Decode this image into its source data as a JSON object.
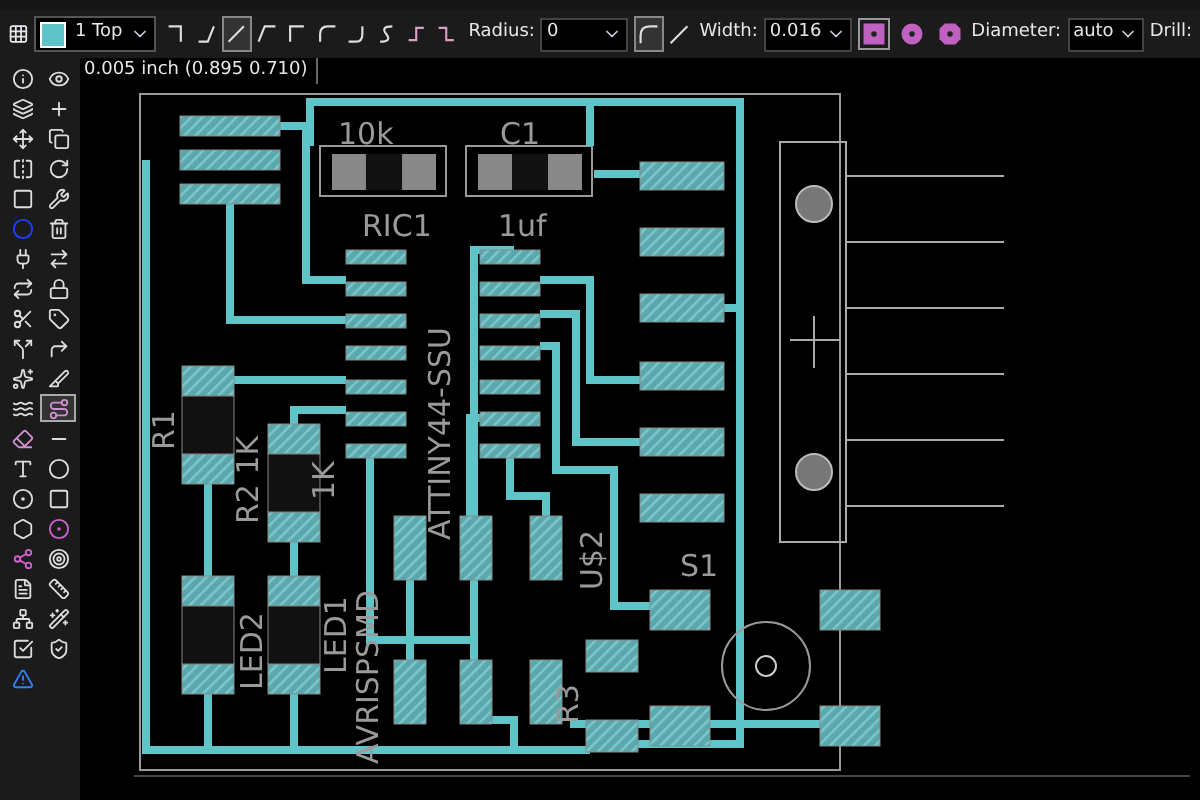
{
  "toolbar": {
    "layer": {
      "value": "1 Top",
      "color": "#5fc4c8"
    },
    "bends": [
      {
        "kind": "corner-right",
        "selected": false
      },
      {
        "kind": "slant-corner",
        "selected": false
      },
      {
        "kind": "diagonal",
        "selected": true
      },
      {
        "kind": "slant-up",
        "selected": false
      },
      {
        "kind": "corner-left",
        "selected": false
      },
      {
        "kind": "round-left",
        "selected": false
      },
      {
        "kind": "round-right",
        "selected": false
      },
      {
        "kind": "s-curve",
        "selected": false
      },
      {
        "kind": "follow-left",
        "selected": false
      },
      {
        "kind": "follow-right",
        "selected": false
      }
    ],
    "radius": {
      "label": "Radius:",
      "value": "0"
    },
    "miters": [
      {
        "kind": "round",
        "selected": true
      },
      {
        "kind": "straight",
        "selected": false
      }
    ],
    "width": {
      "label": "Width:",
      "value": "0.016"
    },
    "via_shapes": [
      {
        "kind": "square",
        "selected": true
      },
      {
        "kind": "round",
        "selected": false
      },
      {
        "kind": "octagon",
        "selected": false
      }
    ],
    "diameter": {
      "label": "Diameter:",
      "value": "auto"
    },
    "drill": {
      "label": "Drill:"
    }
  },
  "coordinates": "0.005 inch (0.895 0.710)",
  "tools": [
    {
      "kind": "info",
      "selected": false
    },
    {
      "kind": "eye",
      "selected": false
    },
    {
      "kind": "layers",
      "selected": false
    },
    {
      "kind": "mark",
      "selected": false
    },
    {
      "kind": "move",
      "selected": false
    },
    {
      "kind": "copy",
      "selected": false
    },
    {
      "kind": "mirror",
      "selected": false
    },
    {
      "kind": "rotate",
      "selected": false
    },
    {
      "kind": "group",
      "selected": false
    },
    {
      "kind": "wrench",
      "selected": false
    },
    {
      "kind": "dot",
      "selected": false
    },
    {
      "kind": "delete",
      "selected": false
    },
    {
      "kind": "plug",
      "selected": false
    },
    {
      "kind": "replace",
      "selected": false
    },
    {
      "kind": "swap",
      "selected": false
    },
    {
      "kind": "lock",
      "selected": false
    },
    {
      "kind": "smash",
      "selected": false
    },
    {
      "kind": "value",
      "selected": false
    },
    {
      "kind": "split",
      "selected": false
    },
    {
      "kind": "miter",
      "selected": false
    },
    {
      "kind": "optimize",
      "selected": false
    },
    {
      "kind": "slice",
      "selected": false
    },
    {
      "kind": "meander",
      "selected": false
    },
    {
      "kind": "route",
      "selected": true
    },
    {
      "kind": "ripup",
      "selected": false
    },
    {
      "kind": "wire",
      "selected": false
    },
    {
      "kind": "text",
      "selected": false
    },
    {
      "kind": "circle",
      "selected": false
    },
    {
      "kind": "arc",
      "selected": false
    },
    {
      "kind": "rect",
      "selected": false
    },
    {
      "kind": "polygon",
      "selected": false
    },
    {
      "kind": "via",
      "selected": false
    },
    {
      "kind": "signal",
      "selected": false
    },
    {
      "kind": "hole",
      "selected": false
    },
    {
      "kind": "attribute",
      "selected": false
    },
    {
      "kind": "dimension",
      "selected": false
    },
    {
      "kind": "ratsnest",
      "selected": false
    },
    {
      "kind": "autoroute",
      "selected": false
    },
    {
      "kind": "erc",
      "selected": false
    },
    {
      "kind": "drc",
      "selected": false
    },
    {
      "kind": "errors",
      "selected": false
    }
  ],
  "board": {
    "labels": [
      {
        "text": "10k",
        "kind": "flat"
      },
      {
        "text": "C1",
        "kind": "flat"
      },
      {
        "text": "RIC1",
        "kind": "flat"
      },
      {
        "text": "1uf",
        "kind": "flat"
      },
      {
        "text": "R1",
        "kind": "rotated"
      },
      {
        "text": "R2 1K",
        "kind": "rotated"
      },
      {
        "text": "1K",
        "kind": "rotated"
      },
      {
        "text": "LED2",
        "kind": "rotated"
      },
      {
        "text": "LED1",
        "kind": "rotated"
      },
      {
        "text": "AVRISPSMD",
        "kind": "rotated"
      },
      {
        "text": "ATTINY44-SSU",
        "kind": "rotated"
      },
      {
        "text": "U$2",
        "kind": "rotated"
      },
      {
        "text": "S1",
        "kind": "flat"
      },
      {
        "text": "R3",
        "kind": "rotated"
      }
    ]
  }
}
